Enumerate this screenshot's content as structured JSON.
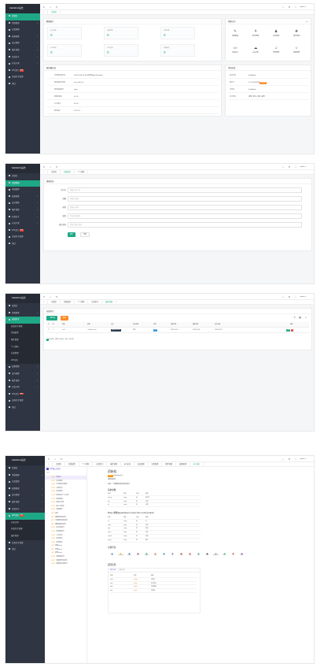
{
  "app": {
    "brand": "FastAdmin后台",
    "user": "admin",
    "menu": {
      "dashboard": "控制台",
      "general": "常规管理",
      "general_config": "系统配置",
      "general_attachment": "附件管理",
      "general_profile": "个人资料",
      "category": "分类管理",
      "auth": "权限管理",
      "addon": "插件管理",
      "member": "会员管理",
      "online": "在线命令",
      "api": "API文档",
      "api_badge": "new",
      "example": "开发示例",
      "test": "测试",
      "online_cmd": "在线命令管理",
      "addon_manage": "插件管理"
    }
  },
  "dashboard": {
    "tabs": [
      "控制台"
    ],
    "card_stats_title": "数据统计",
    "stats": [
      {
        "label": "总会员数",
        "value": "0"
      },
      {
        "label": "总插件数",
        "value": "0"
      },
      {
        "label": "总附件数",
        "value": "0"
      },
      {
        "label": "今日注册",
        "value": "0"
      },
      {
        "label": "今日登录",
        "value": "0"
      },
      {
        "label": "总管理员",
        "value": "0"
      }
    ],
    "quick_title": "快捷方式",
    "quick": [
      {
        "icon": "✎",
        "label": "系统配置"
      },
      {
        "icon": "⚘",
        "label": "附件管理"
      },
      {
        "icon": "♟",
        "label": "会员管理"
      },
      {
        "icon": "❖",
        "label": "插件管理"
      },
      {
        "icon": "</>",
        "label": "在线命令"
      },
      {
        "icon": "☁",
        "label": "API文档"
      },
      {
        "icon": "♫",
        "label": "分类管理"
      },
      {
        "icon": "☆",
        "label": "权限管理"
      }
    ],
    "server_title": "服务器信息",
    "server": [
      {
        "k": "当前服务器时间",
        "v": "2024-05-08 10:28:36(时区Asia/Shanghai)"
      },
      {
        "k": "服务器操作系统",
        "v": "Linux x86_64"
      },
      {
        "k": "服务器端软件",
        "v": "nginx"
      },
      {
        "k": "数据库版本",
        "v": "8.0.31"
      },
      {
        "k": "PHP版本",
        "v": "8.0.26"
      },
      {
        "k": "服务器IP",
        "v": "127.0.0.1"
      }
    ],
    "sys_title": "系统信息",
    "sys": [
      {
        "k": "程序名称",
        "v": "FastAdmin"
      },
      {
        "k": "版本号",
        "v": "1.5.0.20240328",
        "badge": "检查更新"
      },
      {
        "k": "开发者",
        "v": "FastAdmin"
      },
      {
        "k": "官方网站",
        "v": "官网 | 论坛 | 文档 | 插件"
      }
    ]
  },
  "profile": {
    "tabs": [
      "控制台",
      "系统配置",
      "个人资料"
    ],
    "title": "基础信息",
    "fields": [
      {
        "label": "用户名",
        "placeholder": "请输入用户名"
      },
      {
        "label": "邮箱",
        "placeholder": "请输入邮箱"
      },
      {
        "label": "昵称",
        "placeholder": "请输入昵称"
      },
      {
        "label": "密码",
        "placeholder": "不修改请留空"
      },
      {
        "label": "确认密码",
        "placeholder": "请再次输入密码"
      }
    ],
    "submit": "确定",
    "reset": "重置"
  },
  "command": {
    "tabs": [
      "控制台",
      "系统配置",
      "个人资料",
      "在线命令",
      "插件管理"
    ],
    "title": "在线命令",
    "add": "一键生成",
    "del": "删除",
    "headers": [
      "ID",
      "类型",
      "参数",
      "命令",
      "执行结果",
      "状态",
      "创建时间",
      "更新时间",
      "执行时间",
      "操作"
    ],
    "rows": [
      {
        "id": "1",
        "type": "crud",
        "params": "--table=fa_test",
        "cmd": "php think crud",
        "result": "成功",
        "status": "成功",
        "created": "2024-05-08",
        "updated": "2024-05-08",
        "exec": "2024-05-08",
        "op": "详情"
      }
    ],
    "pager": "显示第 1 到第 1 条记录，总共 1 条记录"
  },
  "apidoc": {
    "tabs": [
      "控制台",
      "系统配置",
      "个人资料",
      "在线命令",
      "插件管理",
      "API文档",
      "会员管理",
      "分类管理",
      "附件管理",
      "权限管理",
      "API文档"
    ],
    "title": "API接口文档",
    "search": "搜索",
    "left_items": [
      {
        "m": "POST",
        "t": "初始化"
      },
      {
        "m": "POST",
        "t": "会员登录"
      },
      {
        "m": "POST",
        "t": "手机验证码登录"
      },
      {
        "m": "POST",
        "t": "注册会员"
      },
      {
        "m": "POST",
        "t": "退出登录"
      },
      {
        "m": "POST",
        "t": "修改会员个人信息"
      },
      {
        "m": "POST",
        "t": "修改邮箱"
      },
      {
        "m": "POST",
        "t": "修改手机号"
      },
      {
        "m": "POST",
        "t": "第三方登录"
      },
      {
        "m": "POST",
        "t": "重置密码"
      },
      {
        "m": "GET",
        "t": "首页"
      },
      {
        "m": "GET",
        "t": "需要登录的接口"
      },
      {
        "m": "GET",
        "t": "不需要登录的接口"
      },
      {
        "m": "GET",
        "t": "需要鉴权的接口"
      },
      {
        "m": "POST",
        "t": "发送验证码"
      },
      {
        "m": "POST",
        "t": "检测验证码"
      },
      {
        "m": "POST",
        "t": "上传文件"
      },
      {
        "m": "POST",
        "t": "发送短信"
      },
      {
        "m": "POST",
        "t": "检测短信"
      },
      {
        "m": "GET",
        "t": "获取token"
      },
      {
        "m": "GET",
        "t": "检测token"
      },
      {
        "m": "GET",
        "t": "刷新token"
      },
      {
        "m": "POST",
        "t": "获取验证码"
      },
      {
        "m": "POST",
        "t": "获取邮件验证码"
      },
      {
        "m": "POST",
        "t": "获取短信验证码"
      }
    ],
    "api_title": "初始化",
    "method": "POST",
    "url": "/api/index/init",
    "desc": "加载初始化",
    "note": "这是一个需要登录的初始化接口",
    "headers_title": "请求参数",
    "param_cols": [
      "名称",
      "类型",
      "必选",
      "描述"
    ],
    "params": [
      {
        "n": "version",
        "t": "string",
        "r": "是",
        "d": "版本号"
      },
      {
        "n": "lng",
        "t": "string",
        "r": "否",
        "d": "经度"
      },
      {
        "n": "lat",
        "t": "string",
        "r": "否",
        "d": "纬度"
      }
    ],
    "body_title": "Body 参数(application/x-www-form-urlencoded)",
    "body": [
      {
        "n": "id",
        "t": "string",
        "r": "是",
        "d": "ID"
      },
      {
        "n": "name",
        "t": "string",
        "r": "是",
        "d": "名称"
      },
      {
        "n": "type",
        "t": "string",
        "r": "否",
        "d": "类型"
      },
      {
        "n": "status",
        "t": "string",
        "r": "否",
        "d": "状态"
      },
      {
        "n": "content",
        "t": "string",
        "r": "否",
        "d": "内容"
      },
      {
        "n": "image",
        "t": "string",
        "r": "否",
        "d": "图片"
      }
    ],
    "sdk_title": "示例代码",
    "sdk": [
      "cURL",
      "JavaScript",
      "jQuery",
      "PHP",
      "Python",
      "Java",
      "Go",
      "C#",
      "Ruby",
      "Swift",
      "Dart",
      "Shell",
      "Objective-C",
      "Node",
      "R",
      "Kotlin"
    ],
    "resp_title": "返回结果",
    "resp_tabs": [
      "成功示例",
      "失败示例"
    ],
    "resp_cols": [
      "名称",
      "类型",
      "描述"
    ],
    "resp": [
      {
        "n": "code",
        "t": "integer",
        "d": "状态码"
      },
      {
        "n": "msg",
        "t": "string",
        "d": "提示信息"
      },
      {
        "n": "data",
        "t": "object",
        "d": "返回数据"
      },
      {
        "n": "time",
        "t": "string",
        "d": "时间戳"
      }
    ]
  }
}
